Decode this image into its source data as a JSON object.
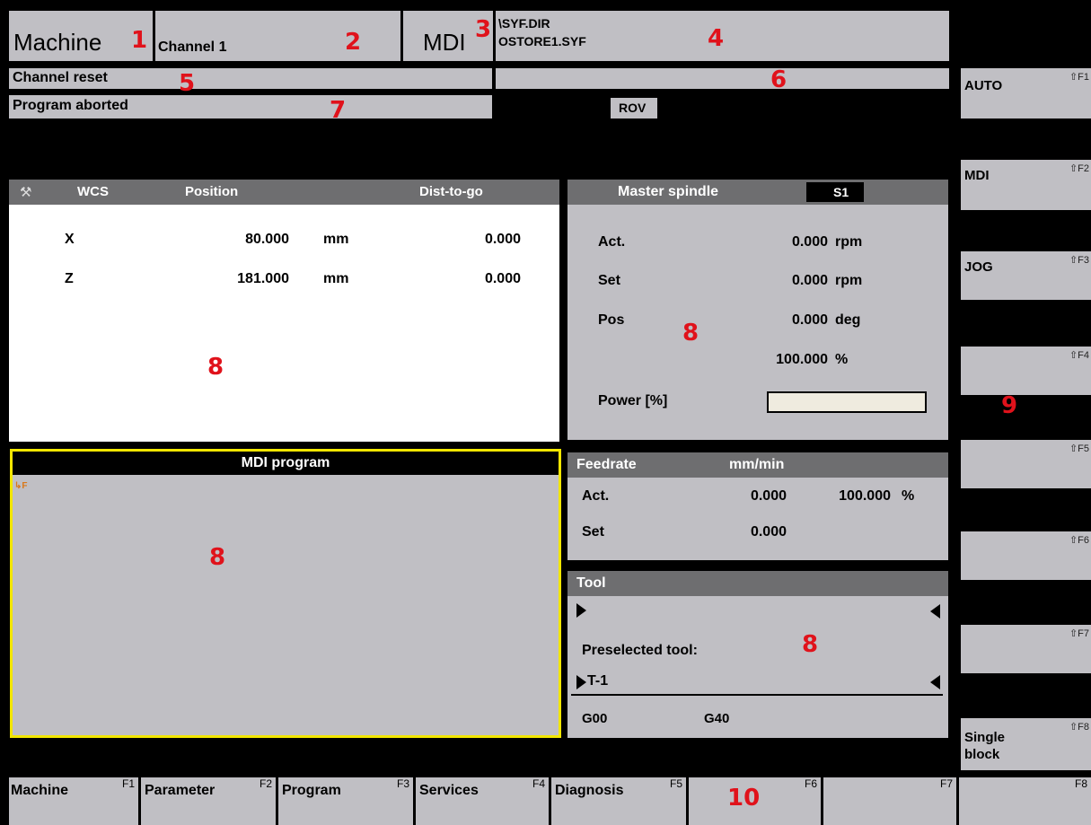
{
  "header": {
    "area": "Machine",
    "channel": "Channel 1",
    "mode": "MDI",
    "path_line1": "\\SYF.DIR",
    "path_line2": "OSTORE1.SYF",
    "channel_status": "Channel reset",
    "program_status": "Program aborted",
    "rov": "ROV"
  },
  "wcs_panel": {
    "col_wcs": "WCS",
    "col_position": "Position",
    "col_dtg": "Dist-to-go",
    "rows": [
      {
        "axis": "X",
        "position": "80.000",
        "unit": "mm",
        "dtg": "0.000"
      },
      {
        "axis": "Z",
        "position": "181.000",
        "unit": "mm",
        "dtg": "0.000"
      }
    ]
  },
  "spindle": {
    "title": "Master spindle",
    "id": "S1",
    "act_label": "Act.",
    "act_value": "0.000",
    "act_unit": "rpm",
    "set_label": "Set",
    "set_value": "0.000",
    "set_unit": "rpm",
    "pos_label": "Pos",
    "pos_value": "0.000",
    "pos_unit": "deg",
    "override_value": "100.000",
    "override_unit": "%",
    "power_label": "Power [%]",
    "power_level": 0
  },
  "mdi": {
    "title": "MDI program"
  },
  "feedrate": {
    "title": "Feedrate",
    "unit": "mm/min",
    "act_label": "Act.",
    "act_value": "0.000",
    "override": "100.000",
    "override_unit": "%",
    "set_label": "Set",
    "set_value": "0.000"
  },
  "tool": {
    "title": "Tool",
    "current": "",
    "preselected_label": "Preselected tool:",
    "preselected": "T-1",
    "gcode1": "G00",
    "gcode2": "G40"
  },
  "vertical_softkeys": [
    {
      "label": "AUTO",
      "key": "⇧F1"
    },
    {
      "label": "MDI",
      "key": "⇧F2"
    },
    {
      "label": "JOG",
      "key": "⇧F3"
    },
    {
      "label": "",
      "key": "⇧F4"
    },
    {
      "label": "",
      "key": "⇧F5"
    },
    {
      "label": "",
      "key": "⇧F6"
    },
    {
      "label": "",
      "key": "⇧F7"
    },
    {
      "label": "Single\nblock",
      "key": "⇧F8"
    }
  ],
  "bottom_softkeys": [
    {
      "label": "Machine",
      "key": "F1"
    },
    {
      "label": "Parameter",
      "key": "F2"
    },
    {
      "label": "Program",
      "key": "F3"
    },
    {
      "label": "Services",
      "key": "F4"
    },
    {
      "label": "Diagnosis",
      "key": "F5"
    },
    {
      "label": "",
      "key": "F6"
    },
    {
      "label": "",
      "key": "F7"
    },
    {
      "label": "",
      "key": "F8"
    }
  ],
  "callouts": [
    "1",
    "2",
    "3",
    "4",
    "5",
    "6",
    "7",
    "8",
    "9",
    "10"
  ],
  "colors": {
    "panel_gray": "#c0bfc4",
    "header_dark": "#6e6e70",
    "callout_red": "#e0121b",
    "mdi_border": "#f2e600"
  }
}
